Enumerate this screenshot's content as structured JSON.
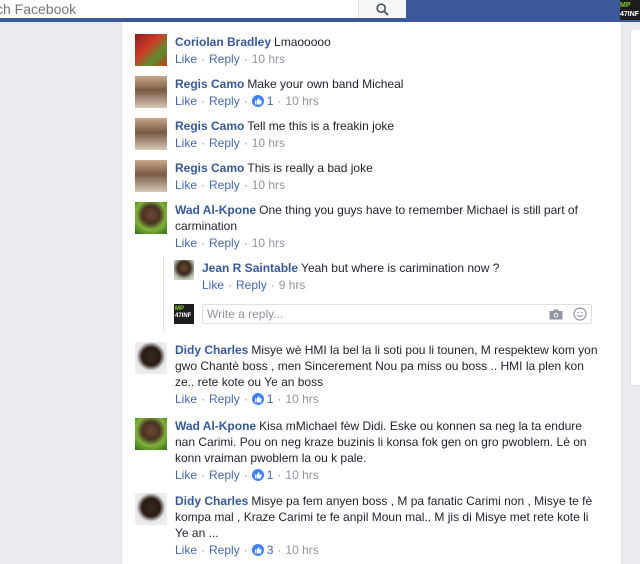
{
  "search": {
    "placeholder": "ch Facebook"
  },
  "badge": {
    "line1": "MP",
    "line2": "47INF"
  },
  "comments": [
    {
      "name": "Coriolan Bradley",
      "text": "Lmaooooo",
      "like": "Like",
      "reply": "Reply",
      "time": "10 hrs"
    },
    {
      "name": "Regis Camo",
      "text": "Make your own band Micheal",
      "like": "Like",
      "reply": "Reply",
      "likes": "1",
      "time": "10 hrs"
    },
    {
      "name": "Regis Camo",
      "text": "Tell me this is a freakin joke",
      "like": "Like",
      "reply": "Reply",
      "time": "10 hrs"
    },
    {
      "name": "Regis Camo",
      "text": "This is really a bad joke",
      "like": "Like",
      "reply": "Reply",
      "time": "10 hrs"
    },
    {
      "name": "Wad Al-Kpone",
      "text": "One thing you guys have to remember Michael is still part of carmination",
      "like": "Like",
      "reply": "Reply",
      "time": "10 hrs"
    },
    {
      "name": "Didy Charles",
      "text": "Misye wè HMI la bel la li soti pou li tounen, M respektew kom yon gwo Chantè boss , men Sincerement Nou pa miss ou boss .. HMI la plen kon ze.. rete kote ou Ye an boss",
      "like": "Like",
      "reply": "Reply",
      "likes": "1",
      "time": "10 hrs"
    },
    {
      "name": "Wad Al-Kpone",
      "text": "Kisa mMichael fèw Didi. Eske ou konnen sa neg la ta endure nan Carimi. Pou on neg kraze buzinis li konsa fok gen on gro pwoblem. Lè on konn vraiman pwoblem la ou k pale.",
      "like": "Like",
      "reply": "Reply",
      "likes": "1",
      "time": "10 hrs"
    },
    {
      "name": "Didy Charles",
      "text": "Misye pa fem anyen boss , M pa fanatic Carimi non , Misye te fè kompa mal , Kraze Carimi te fe anpil Moun mal.. M jis di Misye met rete kote li Ye an ...",
      "like": "Like",
      "reply": "Reply",
      "likes": "3",
      "time": "10 hrs"
    }
  ],
  "reply": {
    "name": "Jean R Saintable",
    "text": "Yeah but where is carimination now ?",
    "like": "Like",
    "reply": "Reply",
    "time": "9 hrs"
  },
  "reply_box": {
    "placeholder": "Write a reply..."
  },
  "my_avatar": {
    "line1": "MP",
    "line2": "47INF"
  },
  "dot": "·"
}
